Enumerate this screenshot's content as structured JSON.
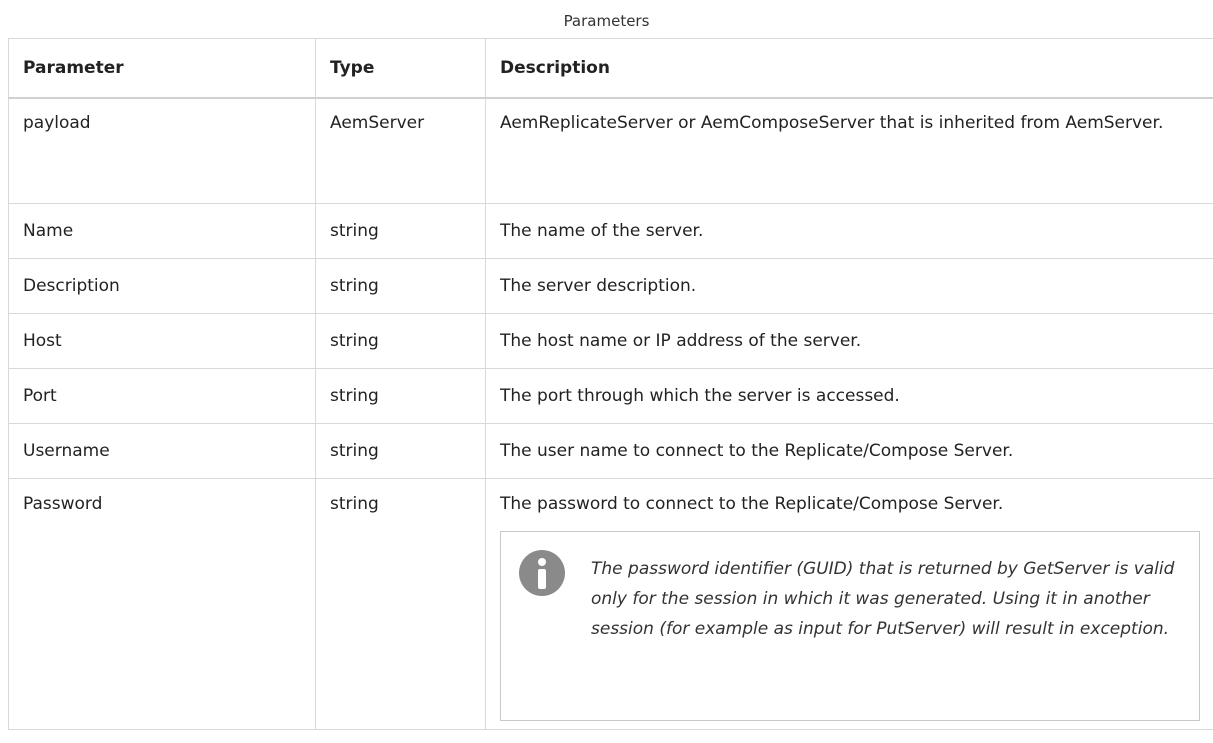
{
  "caption": "Parameters",
  "headers": {
    "parameter": "Parameter",
    "type": "Type",
    "description": "Description"
  },
  "rows": [
    {
      "parameter": "payload",
      "type": "AemServer",
      "description": "AemReplicateServer or AemComposeServer that is inherited from AemServer."
    },
    {
      "parameter": "Name",
      "type": "string",
      "description": "The name of the server."
    },
    {
      "parameter": "Description",
      "type": "string",
      "description": "The server description."
    },
    {
      "parameter": "Host",
      "type": "string",
      "description": "The host name or IP address of the server."
    },
    {
      "parameter": "Port",
      "type": "string",
      "description": "The port through which the server is accessed."
    },
    {
      "parameter": "Username",
      "type": "string",
      "description": "The user name to connect to the Replicate/Compose Server."
    },
    {
      "parameter": "Password",
      "type": "string",
      "description": "The password to connect to the Replicate/Compose Server."
    }
  ],
  "note": {
    "icon": "info-icon",
    "text": "The password identifier (GUID) that is returned by GetServer is valid only for the session in which it was generated. Using it in another session (for example as input for PutServer) will result in exception."
  }
}
